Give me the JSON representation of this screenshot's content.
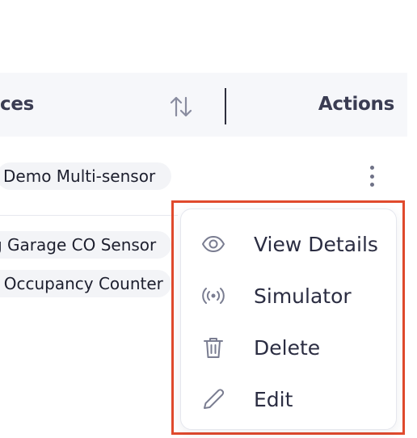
{
  "table": {
    "column_title": "ces",
    "actions_title": "Actions",
    "rows": [
      {
        "device": "Demo Multi-sensor"
      },
      {
        "device": "g Garage CO Sensor"
      },
      {
        "device": ". Occupancy Counter"
      }
    ]
  },
  "icons": {
    "sort": "sort-arrows-icon",
    "more": "kebab-more-icon",
    "view": "eye-icon",
    "simulator": "broadcast-icon",
    "delete": "trash-icon",
    "edit": "pencil-icon"
  },
  "menu": {
    "items": [
      {
        "label": "View Details"
      },
      {
        "label": "Simulator"
      },
      {
        "label": "Delete"
      },
      {
        "label": "Edit"
      }
    ]
  },
  "colors": {
    "highlight": "#e04a2d",
    "icon_gray": "#7a7d91",
    "header_bg": "#f6f7fa"
  }
}
